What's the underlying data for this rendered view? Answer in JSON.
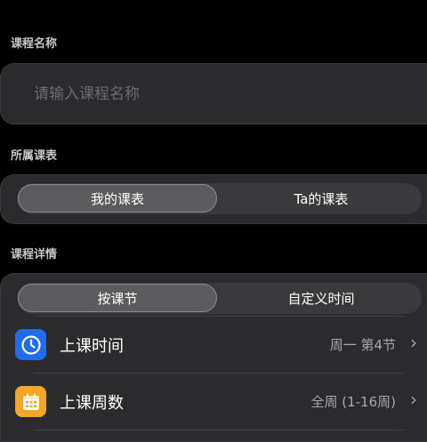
{
  "sections": {
    "name_label": "课程名称",
    "schedule_label": "所属课表",
    "detail_label": "课程详情"
  },
  "name_input": {
    "placeholder": "请输入课程名称",
    "value": ""
  },
  "schedule_tabs": {
    "options": [
      "我的课表",
      "Ta的课表"
    ],
    "selected": "我的课表"
  },
  "detail_tabs": {
    "options": [
      "按课节",
      "自定义时间"
    ],
    "selected": "按课节"
  },
  "rows": [
    {
      "title": "上课时间",
      "value": "周一 第4节",
      "icon": "clock-icon",
      "icon_color": "#1e6cf0"
    },
    {
      "title": "上课周数",
      "value": "全周 (1-16周)",
      "icon": "calendar-icon",
      "icon_color": "#f5a623"
    }
  ],
  "chevron": "›"
}
